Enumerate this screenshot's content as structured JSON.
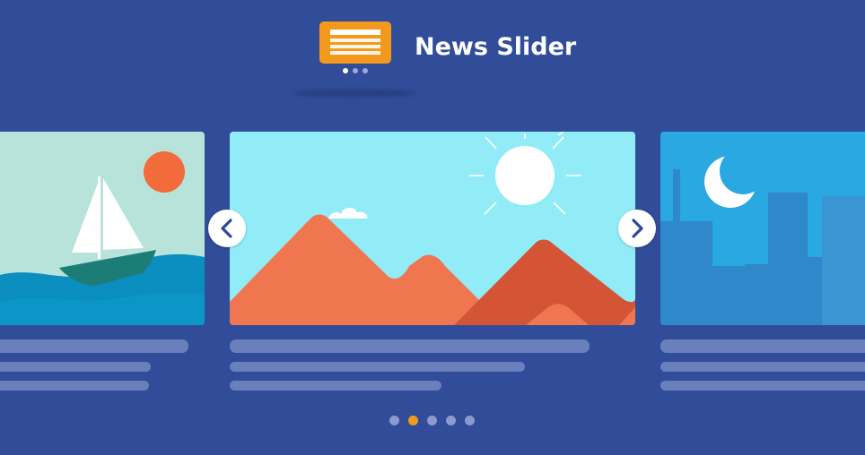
{
  "header": {
    "title": "News Slider"
  },
  "slider": {
    "active_index": 1,
    "slides": [
      "sailboat",
      "mountains",
      "night-city"
    ],
    "pagination_count": 5,
    "active_dot": 1
  },
  "colors": {
    "background": "#314d9a",
    "accent": "#f39a1e",
    "placeholder_line": "#6a80bd",
    "inactive_dot": "#8a9bcc"
  },
  "icons": {
    "logo": "news-card-icon",
    "prev": "chevron-left-icon",
    "next": "chevron-right-icon"
  }
}
